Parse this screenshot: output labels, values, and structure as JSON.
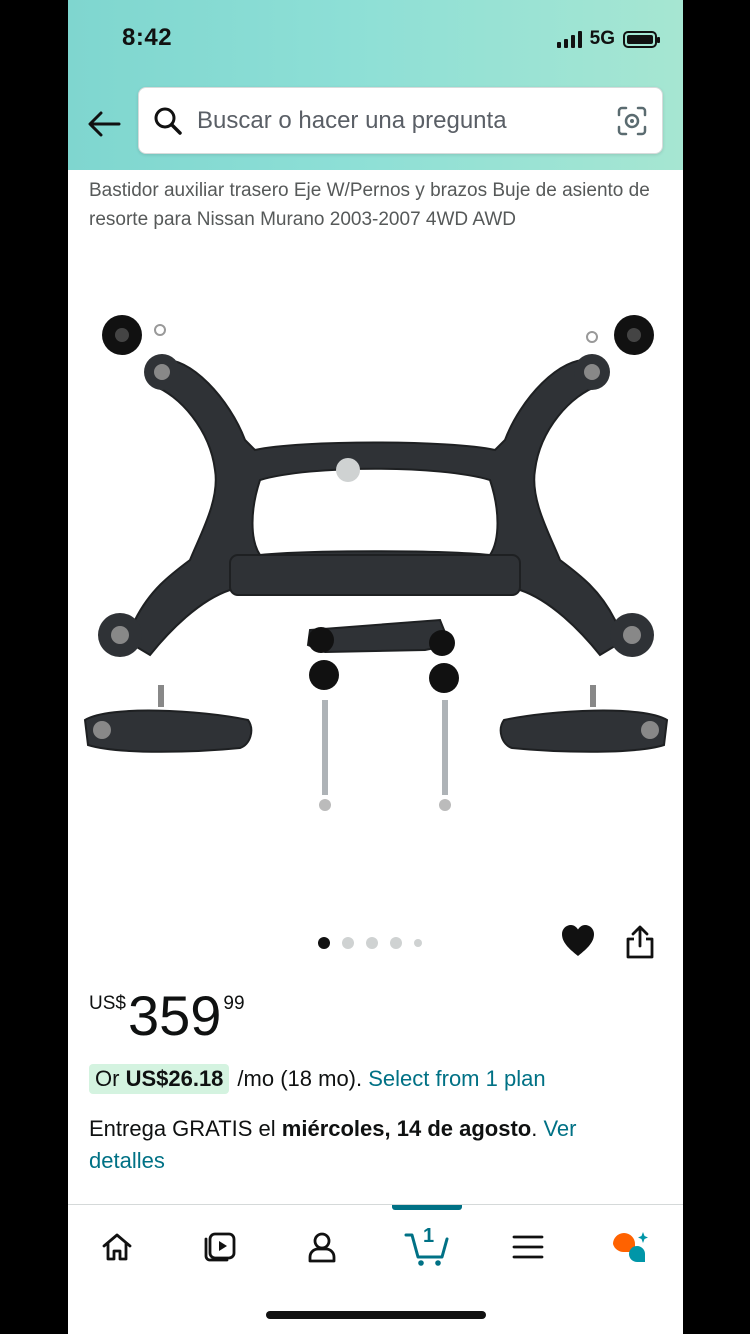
{
  "status_bar": {
    "time": "8:42",
    "network": "5G"
  },
  "search": {
    "placeholder": "Buscar o hacer una pregunta"
  },
  "product": {
    "title": "Bastidor auxiliar trasero Eje W/Pernos y brazos Buje de asiento de resorte para Nissan Murano 2003-2007 4WD AWD",
    "image_dots_total": 5,
    "image_dots_active": 1
  },
  "price": {
    "currency": "US$",
    "whole": "359",
    "fraction": "99"
  },
  "installment": {
    "prefix": "Or ",
    "amount": "US$26.18",
    "period": "/mo (18 mo).",
    "link": "Select from 1 plan"
  },
  "delivery": {
    "text": "Entrega GRATIS el ",
    "date": "miércoles, 14 de agosto",
    "end": ".",
    "link": "Ver detalles"
  },
  "bottom_nav": {
    "cart_count": "1",
    "items": [
      "home-icon",
      "video-icon",
      "account-icon",
      "cart-icon",
      "menu-icon",
      "rufus-icon"
    ]
  },
  "colors": {
    "accent": "#007185",
    "header_start": "#7fd6cf",
    "header_end": "#a6e6d2",
    "pill": "#d4f3e0",
    "price_text": "#0f1111"
  }
}
